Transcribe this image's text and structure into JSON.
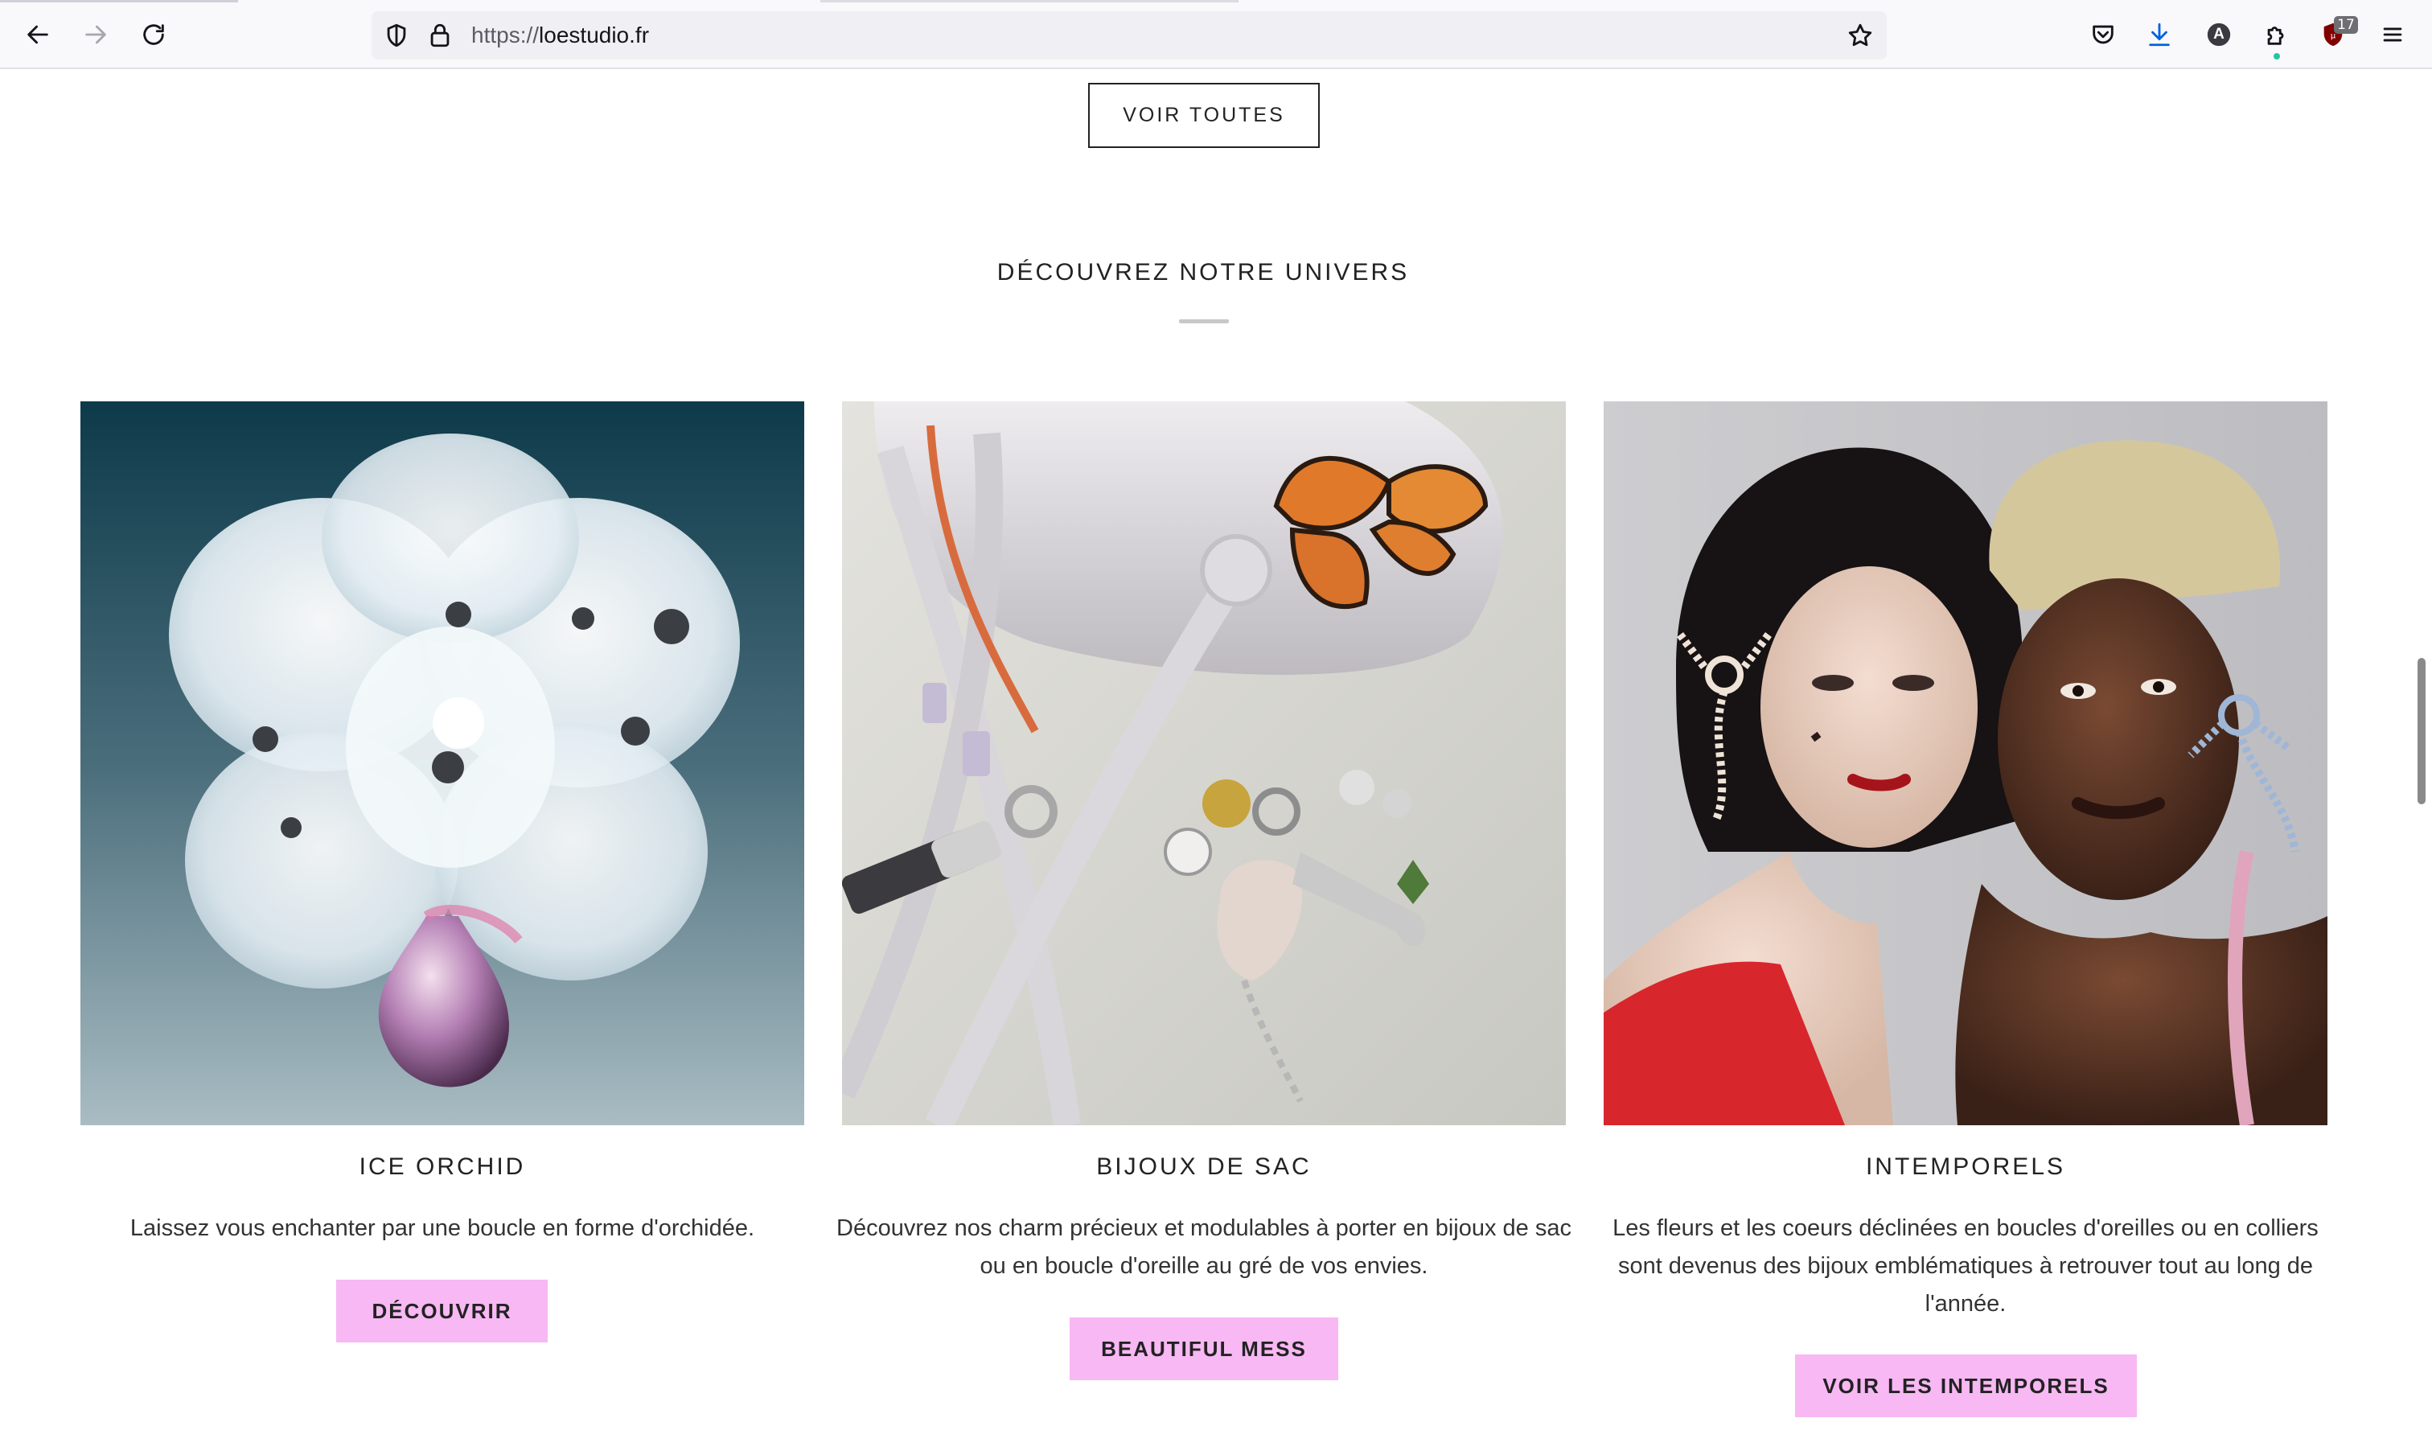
{
  "browser": {
    "url_protocol": "https://",
    "url_domain": "loestudio.fr",
    "extension_badge_count": "17",
    "nav_icons": [
      "back-arrow-icon",
      "forward-arrow-icon",
      "reload-icon"
    ],
    "url_icons": [
      "shield-icon",
      "lock-icon",
      "bookmark-star-icon"
    ],
    "toolbar_icons": [
      "pocket-icon",
      "download-icon",
      "account-avatar-icon",
      "extensions-puzzle-icon",
      "ublock-shield-icon",
      "hamburger-menu-icon"
    ],
    "account_initial": "A"
  },
  "page": {
    "see_all_button": "VOIR TOUTES",
    "section_title": "DÉCOUVREZ NOTRE UNIVERS",
    "cards": [
      {
        "heading": "ICE ORCHID",
        "text": "Laissez vous enchanter par une boucle en forme d'orchidée.",
        "button": "DÉCOUVRIR"
      },
      {
        "heading": "BIJOUX DE SAC",
        "text": "Découvrez nos charm précieux et modulables à porter en bijoux de sac ou en boucle d'oreille au gré de vos envies.",
        "button": "BEAUTIFUL MESS"
      },
      {
        "heading": "INTEMPORELS",
        "text": "Les fleurs et les coeurs déclinées en boucles d'oreilles ou en colliers sont devenus des bijoux emblématiques à retrouver tout au long de l'année.",
        "button": "VOIR LES INTEMPORELS"
      }
    ]
  },
  "colors": {
    "cta_background": "#f7b8f3",
    "text": "#222222",
    "browser_toolbar": "#f9f9fb",
    "urlbar": "#f0f0f4"
  }
}
